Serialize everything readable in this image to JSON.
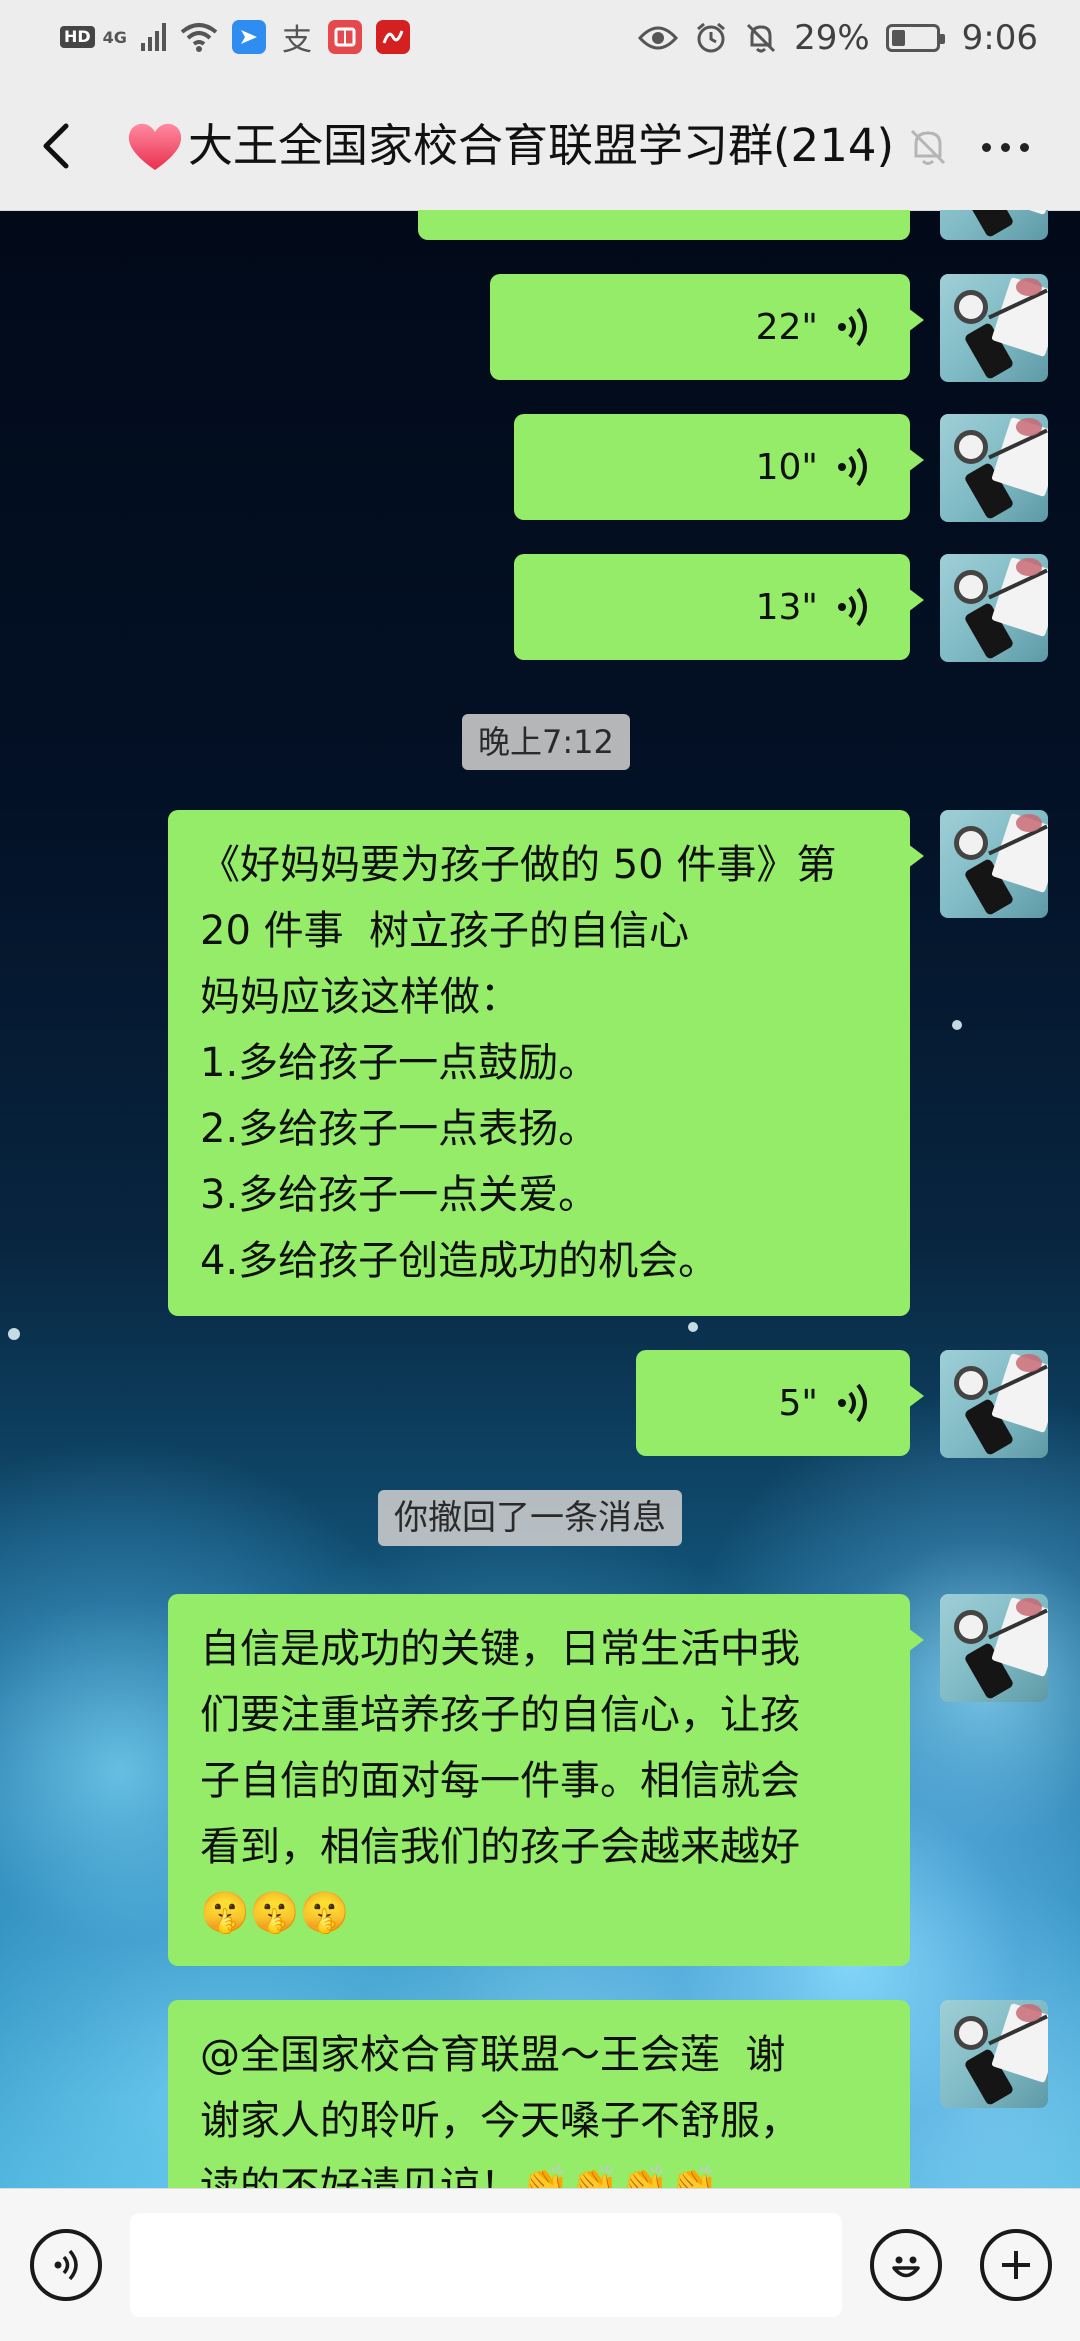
{
  "status_bar": {
    "hd": "HD",
    "network": "4G",
    "app_icons": [
      "feishu-icon",
      "alipay-icon",
      "reader-icon",
      "news-icon"
    ],
    "alipay_glyph": "支",
    "battery": "29%",
    "time": "9:06"
  },
  "header": {
    "title": "大王全国家校合育联盟学习群(214)",
    "muted": true
  },
  "messages": [
    {
      "type": "voice",
      "duration": "",
      "partial": true
    },
    {
      "type": "voice",
      "duration": "22\""
    },
    {
      "type": "voice",
      "duration": "10\""
    },
    {
      "type": "voice",
      "duration": "13\""
    },
    {
      "type": "time",
      "text": "晚上7:12"
    },
    {
      "type": "text",
      "text": "《好妈妈要为孩子做的 50 件事》第\n20 件事  树立孩子的自信心\n妈妈应该这样做：\n1.多给孩子一点鼓励。\n2.多给孩子一点表扬。\n3.多给孩子一点关爱。\n4.多给孩子创造成功的机会。"
    },
    {
      "type": "voice",
      "duration": "5\""
    },
    {
      "type": "system",
      "text": "你撤回了一条消息"
    },
    {
      "type": "text",
      "text": "自信是成功的关键，日常生活中我\n们要注重培养孩子的自信心，让孩\n子自信的面对每一件事。相信就会\n看到，相信我们的孩子会越来越好\n🤫🤫🤫"
    },
    {
      "type": "text",
      "text": "@全国家校合育联盟～王会莲  谢\n谢家人的聆听，今天嗓子不舒服，\n读的不好请见谅！👏👏👏👏",
      "partial": true
    }
  ],
  "input": {
    "placeholder": ""
  },
  "colors": {
    "bubble": "#95ec69",
    "bar": "#ededed"
  }
}
